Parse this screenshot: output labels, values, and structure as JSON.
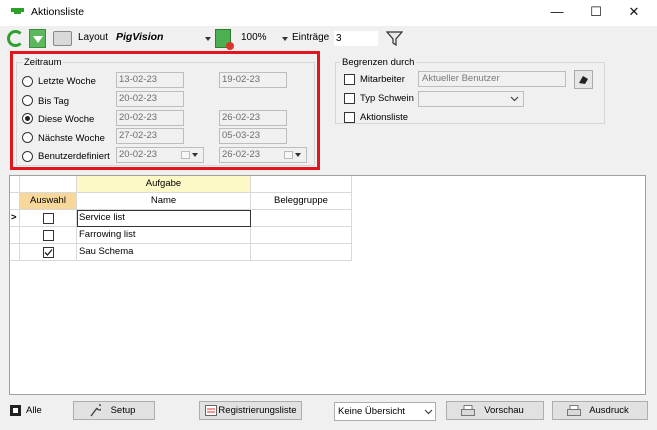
{
  "window": {
    "title": "Aktionsliste",
    "minimize": "—",
    "maximize": "☐",
    "close": "✕"
  },
  "toolbar": {
    "layout_label": "Layout",
    "layout_name": "PigVision",
    "zoom": "100%",
    "entries_label": "Einträge",
    "entries_value": "3"
  },
  "zeitraum": {
    "legend": "Zeitraum",
    "options": [
      {
        "label": "Letzte Woche",
        "from": "13-02-23",
        "to": "19-02-23",
        "selected": false
      },
      {
        "label": "Bis Tag",
        "from": "20-02-23",
        "to": "",
        "selected": false
      },
      {
        "label": "Diese Woche",
        "from": "20-02-23",
        "to": "26-02-23",
        "selected": true
      },
      {
        "label": "Nächste Woche",
        "from": "27-02-23",
        "to": "05-03-23",
        "selected": false
      },
      {
        "label": "Benutzerdefiniert",
        "from": "20-02-23",
        "to": "26-02-23",
        "selected": false
      }
    ]
  },
  "begrenzen": {
    "legend": "Begrenzen durch",
    "mitarbeiter_label": "Mitarbeiter",
    "mitarbeiter_value": "Aktueller Benutzer",
    "typ_label": "Typ Schwein",
    "typ_value": "",
    "aktionsliste_label": "Aktionsliste"
  },
  "grid": {
    "group_header": "Aufgabe",
    "columns": {
      "auswahl": "Auswahl",
      "name": "Name",
      "beleggruppe": "Beleggruppe"
    },
    "rows": [
      {
        "checked": false,
        "name": "Service list",
        "beleggruppe": "",
        "current": true
      },
      {
        "checked": false,
        "name": "Farrowing list",
        "beleggruppe": "",
        "current": false
      },
      {
        "checked": true,
        "name": "Sau Schema",
        "beleggruppe": "",
        "current": false
      }
    ]
  },
  "bottom": {
    "alle_label": "Alle",
    "setup_label": "Setup",
    "registrierungsliste_label": "Registrierungsliste",
    "uebersicht_value": "Keine Übersicht",
    "vorschau_label": "Vorschau",
    "ausdruck_label": "Ausdruck"
  },
  "colors": {
    "highlight_frame": "#e3141b",
    "header_yellow": "#fdf9c6",
    "header_orange": "#f7d89a"
  }
}
